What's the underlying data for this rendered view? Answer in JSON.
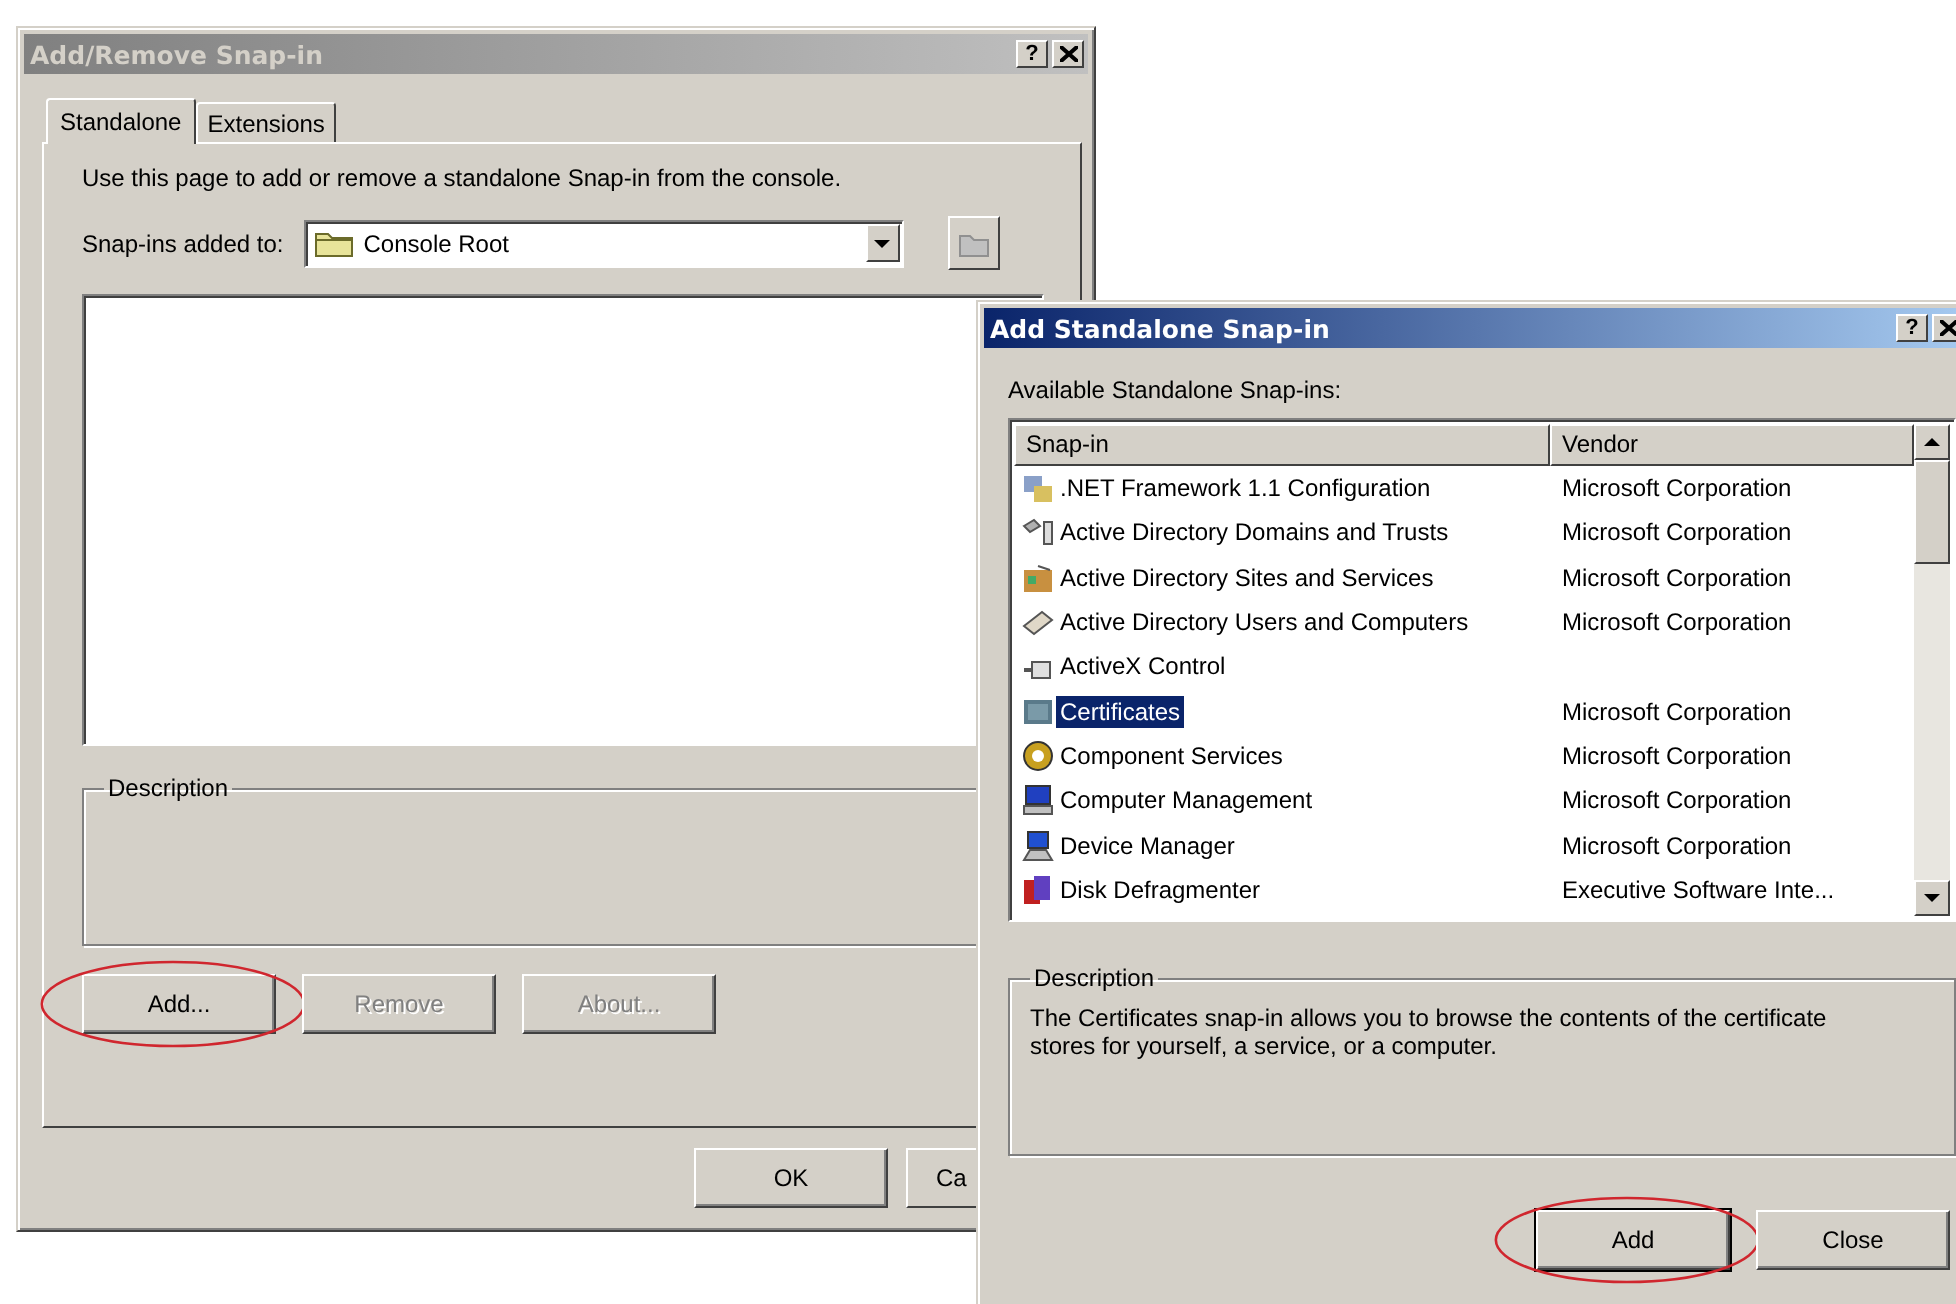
{
  "back_window": {
    "title": "Add/Remove Snap-in",
    "active": false,
    "help_button": "?",
    "tabs": [
      {
        "label": "Standalone",
        "selected": true
      },
      {
        "label": "Extensions",
        "selected": false
      }
    ],
    "intro": "Use this page to add or remove a standalone Snap-in from the console.",
    "snapins_added_to": {
      "label": "Snap-ins added to:",
      "value": "Console Root"
    },
    "description": {
      "label": "Description"
    },
    "buttons": [
      {
        "label": "Add...",
        "disabled": false,
        "circled": true
      },
      {
        "label": "Remove",
        "disabled": true,
        "circled": false
      },
      {
        "label": "About...",
        "disabled": true,
        "circled": false
      }
    ],
    "footer_buttons": [
      {
        "label": "OK"
      },
      {
        "label": "Ca"
      }
    ]
  },
  "front_window": {
    "title": "Add Standalone Snap-in",
    "active": true,
    "help_button": "?",
    "list_label": "Available Standalone Snap-ins:",
    "columns": [
      "Snap-in",
      "Vendor"
    ],
    "rows": [
      {
        "name": ".NET Framework 1.1 Configuration",
        "vendor": "Microsoft Corporation",
        "selected": false
      },
      {
        "name": "Active Directory Domains and Trusts",
        "vendor": "Microsoft Corporation",
        "selected": false
      },
      {
        "name": "Active Directory Sites and Services",
        "vendor": "Microsoft Corporation",
        "selected": false
      },
      {
        "name": "Active Directory Users and Computers",
        "vendor": "Microsoft Corporation",
        "selected": false
      },
      {
        "name": "ActiveX Control",
        "vendor": "",
        "selected": false
      },
      {
        "name": "Certificates",
        "vendor": "Microsoft Corporation",
        "selected": true
      },
      {
        "name": "Component Services",
        "vendor": "Microsoft Corporation",
        "selected": false
      },
      {
        "name": "Computer Management",
        "vendor": "Microsoft Corporation",
        "selected": false
      },
      {
        "name": "Device Manager",
        "vendor": "Microsoft Corporation",
        "selected": false
      },
      {
        "name": "Disk Defragmenter",
        "vendor": "Executive Software Inte...",
        "selected": false
      }
    ],
    "description": {
      "label": "Description",
      "text": "The Certificates snap-in allows you to browse the contents of the certificate stores for yourself, a service, or a computer."
    },
    "buttons": [
      {
        "label": "Add",
        "default": true,
        "circled": true
      },
      {
        "label": "Close",
        "default": false,
        "circled": false
      }
    ]
  }
}
